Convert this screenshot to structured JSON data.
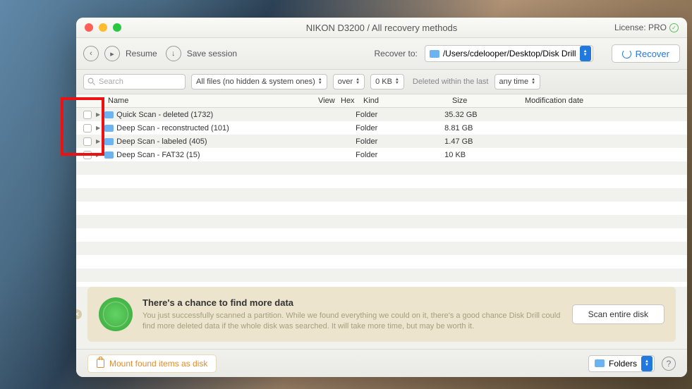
{
  "title": "NIKON D3200 / All recovery methods",
  "license": "License: PRO",
  "toolbar": {
    "resume": "Resume",
    "save_session": "Save session",
    "recover_to": "Recover to:",
    "path": "/Users/cdelooper/Desktop/Disk Drill",
    "recover_btn": "Recover"
  },
  "filters": {
    "search_placeholder": "Search",
    "all_files": "All files (no hidden & system ones)",
    "over": "over",
    "size": "0 KB",
    "deleted_label": "Deleted within the last",
    "any_time": "any time"
  },
  "headers": {
    "name": "Name",
    "view": "View",
    "hex": "Hex",
    "kind": "Kind",
    "size": "Size",
    "date": "Modification date"
  },
  "rows": [
    {
      "name": "Quick Scan - deleted (1732)",
      "kind": "Folder",
      "size": "35.32 GB"
    },
    {
      "name": "Deep Scan - reconstructed (101)",
      "kind": "Folder",
      "size": "8.81 GB"
    },
    {
      "name": "Deep Scan - labeled (405)",
      "kind": "Folder",
      "size": "1.47 GB"
    },
    {
      "name": "Deep Scan - FAT32 (15)",
      "kind": "Folder",
      "size": "10 KB"
    }
  ],
  "banner": {
    "title": "There's a chance to find more data",
    "body": "You just successfully scanned a partition. While we found everything we could on it, there's a good chance Disk Drill could find more deleted data if the whole disk was searched. It will take more time, but may be worth it.",
    "button": "Scan entire disk"
  },
  "footer": {
    "mount": "Mount found items as disk",
    "view_mode": "Folders"
  }
}
